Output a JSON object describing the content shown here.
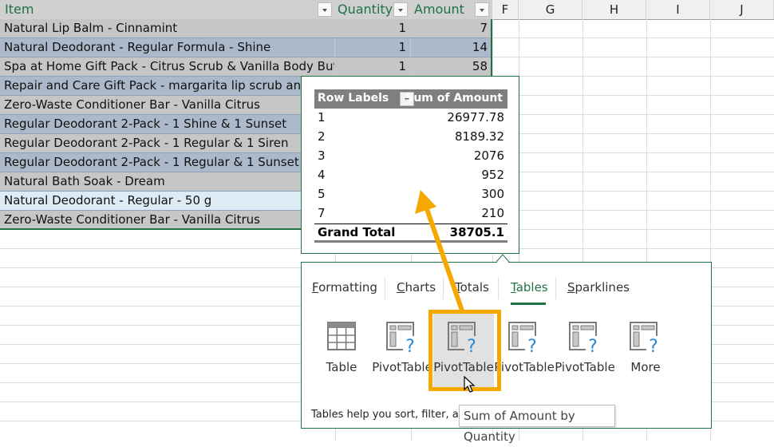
{
  "sheet": {
    "columns": {
      "item_header": "Item",
      "quantity_header": "Quantity",
      "amount_header": "Amount",
      "letters": [
        "F",
        "G",
        "H",
        "I",
        "J"
      ]
    },
    "rows": [
      {
        "item": "Natural Lip Balm - Cinnamint",
        "quantity": "1",
        "amount": "7"
      },
      {
        "item": "Natural Deodorant - Regular Formula - Shine",
        "quantity": "1",
        "amount": "14"
      },
      {
        "item": "Spa at Home Gift Pack - Citrus Scrub & Vanilla Body Butter",
        "quantity": "1",
        "amount": "58"
      },
      {
        "item": "Repair and Care Gift Pack - margarita lip scrub and p",
        "quantity": "",
        "amount": ""
      },
      {
        "item": "Zero-Waste Conditioner Bar - Vanilla Citrus",
        "quantity": "",
        "amount": ""
      },
      {
        "item": "Regular Deodorant 2-Pack - 1 Shine & 1 Sunset",
        "quantity": "",
        "amount": ""
      },
      {
        "item": "Regular Deodorant 2-Pack - 1 Regular & 1 Siren",
        "quantity": "",
        "amount": ""
      },
      {
        "item": "Regular Deodorant 2-Pack - 1 Regular & 1 Sunset",
        "quantity": "",
        "amount": ""
      },
      {
        "item": "Natural Bath Soak - Dream",
        "quantity": "",
        "amount": ""
      },
      {
        "item": "Natural Deodorant - Regular - 50 g",
        "quantity": "",
        "amount": ""
      },
      {
        "item": "Zero-Waste Conditioner Bar - Vanilla Citrus",
        "quantity": "",
        "amount": ""
      }
    ]
  },
  "pivot_preview": {
    "row_labels_header": "Row Labels",
    "value_header": "Sum of Amount",
    "rows": [
      {
        "label": "1",
        "value": "26977.78"
      },
      {
        "label": "2",
        "value": "8189.32"
      },
      {
        "label": "3",
        "value": "2076"
      },
      {
        "label": "4",
        "value": "952"
      },
      {
        "label": "5",
        "value": "300"
      },
      {
        "label": "7",
        "value": "210"
      }
    ],
    "grand_total_label": "Grand Total",
    "grand_total_value": "38705.1"
  },
  "quick_analysis": {
    "tabs": [
      {
        "label": "Formatting",
        "accel": "F",
        "rest": "ormatting",
        "active": false
      },
      {
        "label": "Charts",
        "accel": "C",
        "rest": "harts",
        "active": false
      },
      {
        "label": "Totals",
        "accel": "T",
        "rest": "otals",
        "active": false
      },
      {
        "label": "Tables",
        "accel": "T",
        "rest": "ables",
        "active": true
      },
      {
        "label": "Sparklines",
        "accel": "S",
        "rest": "parklines",
        "active": false
      }
    ],
    "items": [
      {
        "label": "Table",
        "icon": "table-icon"
      },
      {
        "label": "PivotTable",
        "icon": "pivottable-icon"
      },
      {
        "label": "PivotTable",
        "icon": "pivottable-icon",
        "hovered": true
      },
      {
        "label": "PivotTable",
        "icon": "pivottable-icon"
      },
      {
        "label": "PivotTable",
        "icon": "pivottable-icon"
      },
      {
        "label": "More",
        "icon": "more-pivottable-icon"
      }
    ],
    "description": "Tables help you sort, filter, and s",
    "tooltip": "Sum of Amount by Quantity"
  },
  "colors": {
    "accent": "#217346",
    "highlight": "#f5a800",
    "band_gray": "#c6c6c6",
    "band_blue": "#acb9ca",
    "selected_row": "#ddebf7",
    "pivot_header": "#7f7f7f"
  }
}
